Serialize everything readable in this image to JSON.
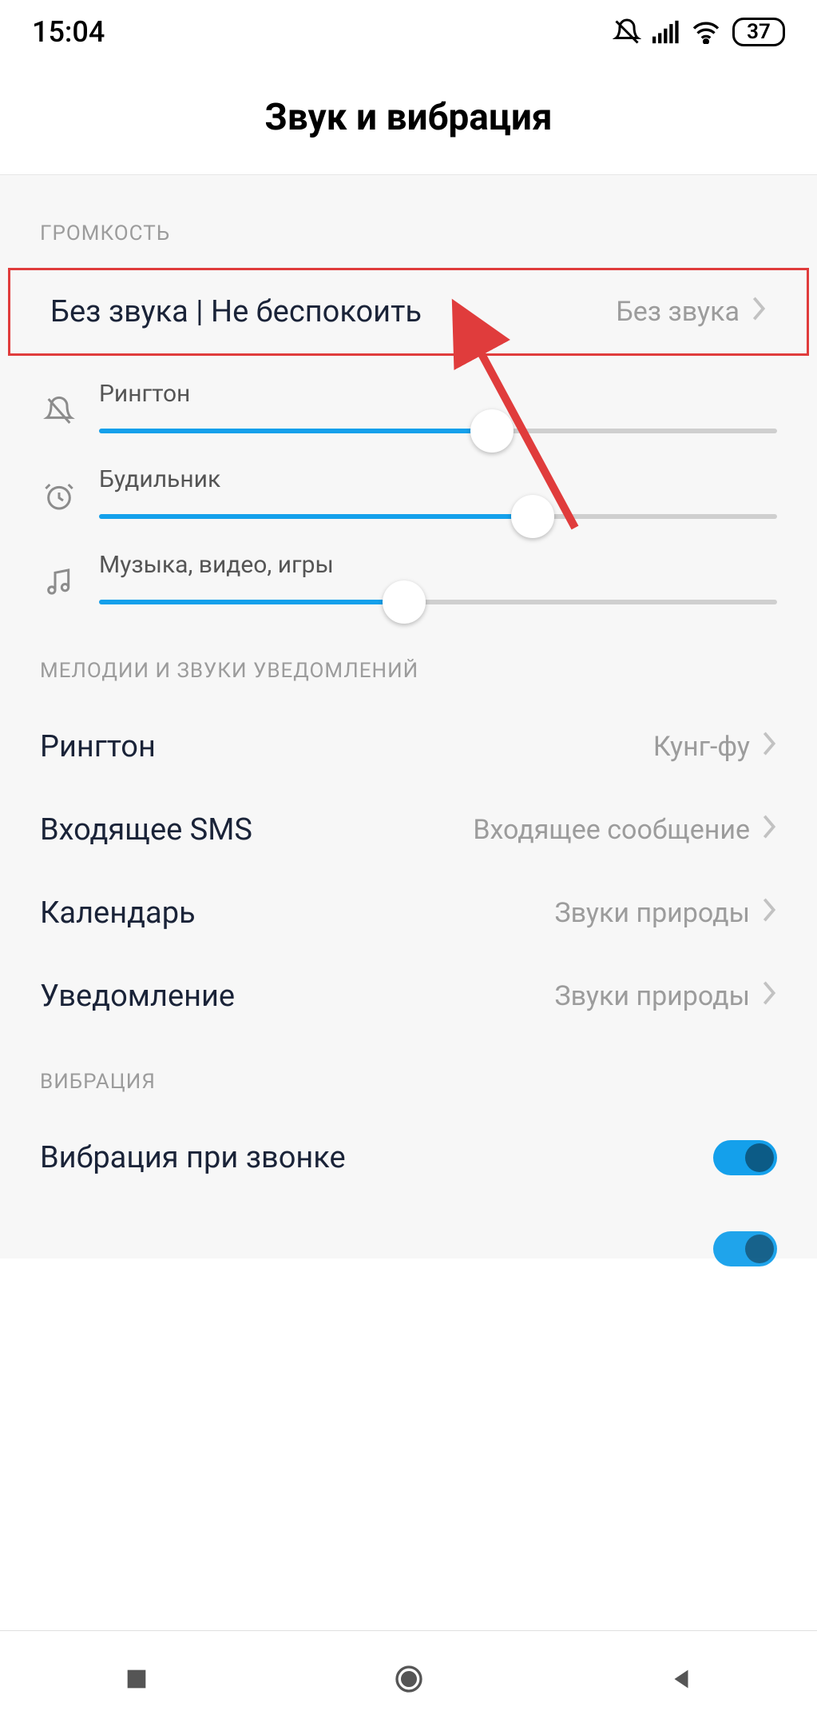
{
  "status": {
    "time": "15:04",
    "battery": "37"
  },
  "title": "Звук и вибрация",
  "sections": {
    "volume": {
      "header": "ГРОМКОСТЬ",
      "silent": {
        "label": "Без звука | Не беспокоить",
        "value": "Без звука"
      },
      "sliders": {
        "ringtone": {
          "label": "Рингтон",
          "percent": 58
        },
        "alarm": {
          "label": "Будильник",
          "percent": 64
        },
        "media": {
          "label": "Музыка, видео, игры",
          "percent": 45
        }
      }
    },
    "sounds": {
      "header": "МЕЛОДИИ И ЗВУКИ УВЕДОМЛЕНИЙ",
      "ringtone": {
        "label": "Рингтон",
        "value": "Кунг-фу"
      },
      "sms": {
        "label": "Входящее SMS",
        "value": "Входящее сообщение"
      },
      "calendar": {
        "label": "Календарь",
        "value": "Звуки природы"
      },
      "notification": {
        "label": "Уведомление",
        "value": "Звуки природы"
      }
    },
    "vibration": {
      "header": "ВИБРАЦИЯ",
      "on_call": {
        "label": "Вибрация при звонке",
        "on": true
      }
    }
  }
}
